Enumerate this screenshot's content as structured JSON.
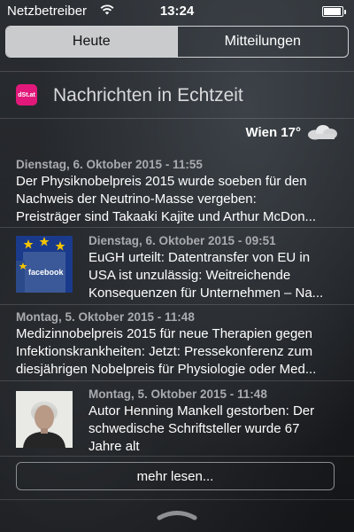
{
  "status_bar": {
    "carrier": "Netzbetreiber",
    "time": "13:24",
    "wifi_icon": "wifi-icon",
    "battery_icon": "battery-icon"
  },
  "tabs": [
    {
      "label": "Heute",
      "selected": true
    },
    {
      "label": "Mitteilungen",
      "selected": false
    }
  ],
  "widget": {
    "app_icon_text": "dSt.at",
    "title": "Nachrichten in Echtzeit",
    "accent": "#e2197a"
  },
  "weather": {
    "label": "Wien 17°",
    "icon": "cloud-icon"
  },
  "news": [
    {
      "date": "Dienstag, 6. Oktober 2015 - 11:55",
      "line1": "Der Physiknobelpreis 2015 wurde soeben für den",
      "line2": "Nachweis der Neutrino-Masse vergeben:",
      "line3": "Preisträger sind Takaaki Kajite und Arthur McDon..."
    },
    {
      "date": "Dienstag, 6. Oktober 2015 - 09:51",
      "line1": "EuGH urteilt: Datentransfer von EU in",
      "line2": "USA ist unzulässig:  Weitreichende",
      "line3": "Konsequenzen für Unternehmen – Na...",
      "thumbnail": "facebook-eu-flag-thumbnail",
      "thumb_text": "facebook"
    },
    {
      "date": "Montag, 5. Oktober 2015 - 11:48",
      "line1": "Medizinnobelpreis 2015 für neue Therapien gegen",
      "line2": "Infektionskrankheiten: Jetzt: Pressekonferenz zum",
      "line3": "diesjährigen Nobelpreis für Physiologie oder Med..."
    },
    {
      "date": "Montag, 5. Oktober 2015 - 11:48",
      "line1": "Autor Henning Mankell gestorben: Der",
      "line2": "schwedische Schriftsteller wurde 67",
      "line3": "Jahre alt",
      "thumbnail": "portrait-thumbnail"
    }
  ],
  "more_button": "mehr lesen...",
  "grabber_icon": "chevron-up-handle-icon"
}
